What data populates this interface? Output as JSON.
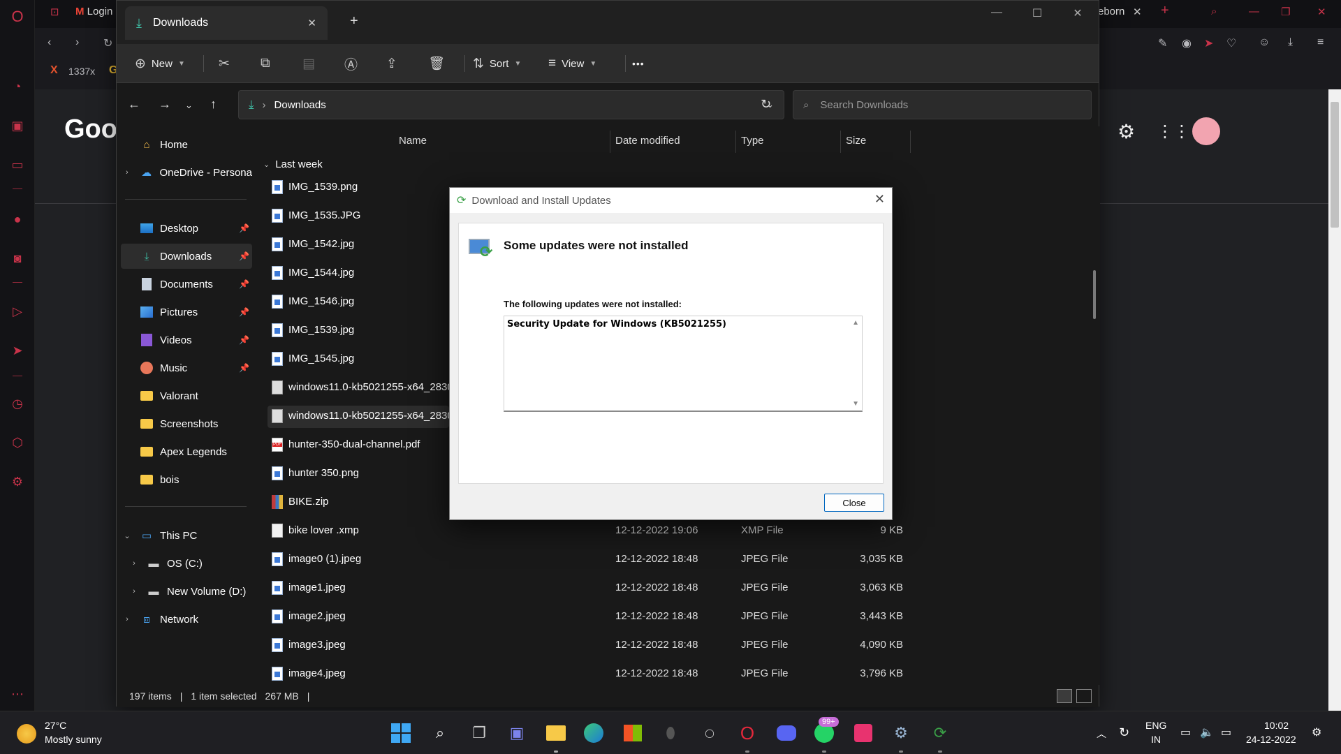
{
  "browser": {
    "tab_gmail": "Login",
    "tab_right": "eborn",
    "bookmark_1337x": "1337x",
    "google_logo_fragment": "Goog"
  },
  "explorer": {
    "tab_title": "Downloads",
    "new_tab_symbol": "+",
    "cmd": {
      "new": "New",
      "sort": "Sort",
      "view": "View",
      "more": "•••"
    },
    "address": {
      "location": "Downloads",
      "separator": "›"
    },
    "search_placeholder": "Search Downloads",
    "nav_pane": {
      "home": "Home",
      "onedrive": "OneDrive - Persona",
      "quick": [
        {
          "label": "Desktop"
        },
        {
          "label": "Downloads"
        },
        {
          "label": "Documents"
        },
        {
          "label": "Pictures"
        },
        {
          "label": "Videos"
        },
        {
          "label": "Music"
        },
        {
          "label": "Valorant"
        },
        {
          "label": "Screenshots"
        },
        {
          "label": "Apex Legends"
        },
        {
          "label": "bois"
        }
      ],
      "this_pc": "This PC",
      "os_c": "OS (C:)",
      "volume_d": "New Volume (D:)",
      "network": "Network"
    },
    "columns": {
      "name": "Name",
      "date": "Date modified",
      "type": "Type",
      "size": "Size"
    },
    "group_label": "Last week",
    "files": [
      {
        "name": "IMG_1539.png",
        "date": "",
        "type": "",
        "size": "",
        "icon": "image"
      },
      {
        "name": "IMG_1535.JPG",
        "date": "",
        "type": "",
        "size": "",
        "icon": "image"
      },
      {
        "name": "IMG_1542.jpg",
        "date": "",
        "type": "",
        "size": "",
        "icon": "image"
      },
      {
        "name": "IMG_1544.jpg",
        "date": "",
        "type": "",
        "size": "",
        "icon": "image"
      },
      {
        "name": "IMG_1546.jpg",
        "date": "",
        "type": "",
        "size": "",
        "icon": "image"
      },
      {
        "name": "IMG_1539.jpg",
        "date": "",
        "type": "",
        "size": "",
        "icon": "image"
      },
      {
        "name": "IMG_1545.jpg",
        "date": "",
        "type": "",
        "size": "",
        "icon": "image"
      },
      {
        "name": "windows11.0-kb5021255-x64_2830",
        "date": "",
        "type": "",
        "size": "",
        "icon": "msu"
      },
      {
        "name": "windows11.0-kb5021255-x64_2830",
        "date": "",
        "type": "",
        "size": "",
        "icon": "msu",
        "selected": true
      },
      {
        "name": "hunter-350-dual-channel.pdf",
        "date": "",
        "type": "",
        "size": "",
        "icon": "pdf"
      },
      {
        "name": "hunter 350.png",
        "date": "",
        "type": "",
        "size": "",
        "icon": "image"
      },
      {
        "name": "BIKE.zip",
        "date": "",
        "type": "",
        "size": "",
        "icon": "zip"
      },
      {
        "name": "bike lover .xmp",
        "date": "12-12-2022 19:06",
        "type": "XMP File",
        "size": "9 KB",
        "icon": "doc"
      },
      {
        "name": "image0 (1).jpeg",
        "date": "12-12-2022 18:48",
        "type": "JPEG File",
        "size": "3,035 KB",
        "icon": "image"
      },
      {
        "name": "image1.jpeg",
        "date": "12-12-2022 18:48",
        "type": "JPEG File",
        "size": "3,063 KB",
        "icon": "image"
      },
      {
        "name": "image2.jpeg",
        "date": "12-12-2022 18:48",
        "type": "JPEG File",
        "size": "3,443 KB",
        "icon": "image"
      },
      {
        "name": "image3.jpeg",
        "date": "12-12-2022 18:48",
        "type": "JPEG File",
        "size": "4,090 KB",
        "icon": "image"
      },
      {
        "name": "image4.jpeg",
        "date": "12-12-2022 18:48",
        "type": "JPEG File",
        "size": "3,796 KB",
        "icon": "image"
      }
    ],
    "status": {
      "count": "197 items",
      "selection": "1 item selected",
      "size": "267 MB",
      "sep": "|"
    }
  },
  "dialog": {
    "title": "Download and Install Updates",
    "heading": "Some updates were not installed",
    "subheading": "The following updates were not installed:",
    "items": [
      "Security Update for Windows (KB5021255)"
    ],
    "close_button": "Close"
  },
  "taskbar": {
    "weather_temp": "27°C",
    "weather_desc": "Mostly sunny",
    "whatsapp_badge": "99+",
    "lang_1": "ENG",
    "lang_2": "IN",
    "time": "10:02",
    "date": "24-12-2022"
  },
  "colors": {
    "accent": "#0067c0",
    "opera_red": "#c9334a",
    "folder_yellow": "#f7c948",
    "explorer_bg": "#191919"
  }
}
